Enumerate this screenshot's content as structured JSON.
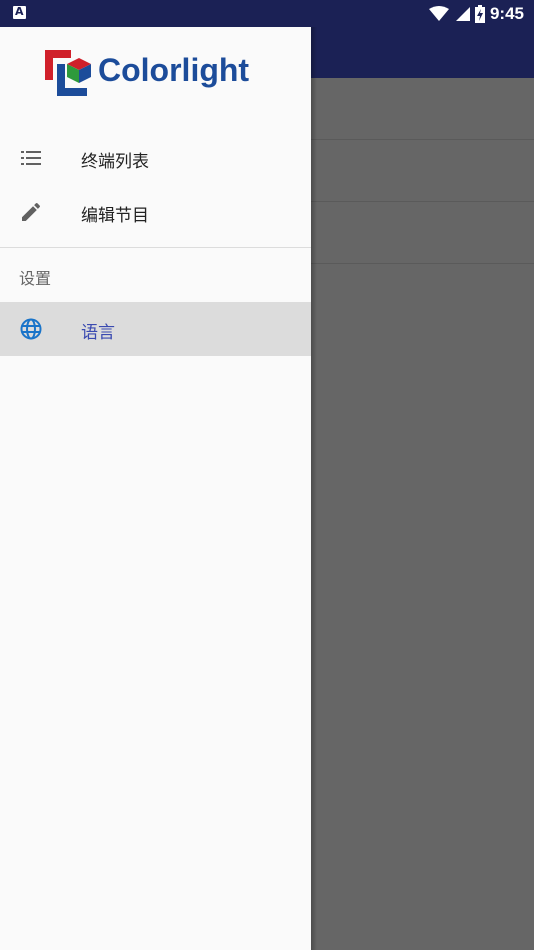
{
  "status_bar": {
    "time": "9:45",
    "icons": [
      "notification-a-icon",
      "wifi-icon",
      "signal-icon",
      "battery-charging-icon"
    ]
  },
  "drawer": {
    "logo_text": "Colorlight",
    "items": [
      {
        "label": "终端列表",
        "icon": "list-icon"
      },
      {
        "label": "编辑节目",
        "icon": "edit-pencil-icon"
      }
    ],
    "settings_header": "设置",
    "settings_items": [
      {
        "label": "语言",
        "icon": "globe-icon",
        "selected": true
      }
    ]
  },
  "colors": {
    "primary_dark": "#1b2155",
    "brand_blue": "#1c4c9a",
    "brand_red": "#d0202a",
    "brand_green": "#2e9a3c",
    "selected_text": "#3a4ab0",
    "selected_bg": "#dcdcdc"
  }
}
